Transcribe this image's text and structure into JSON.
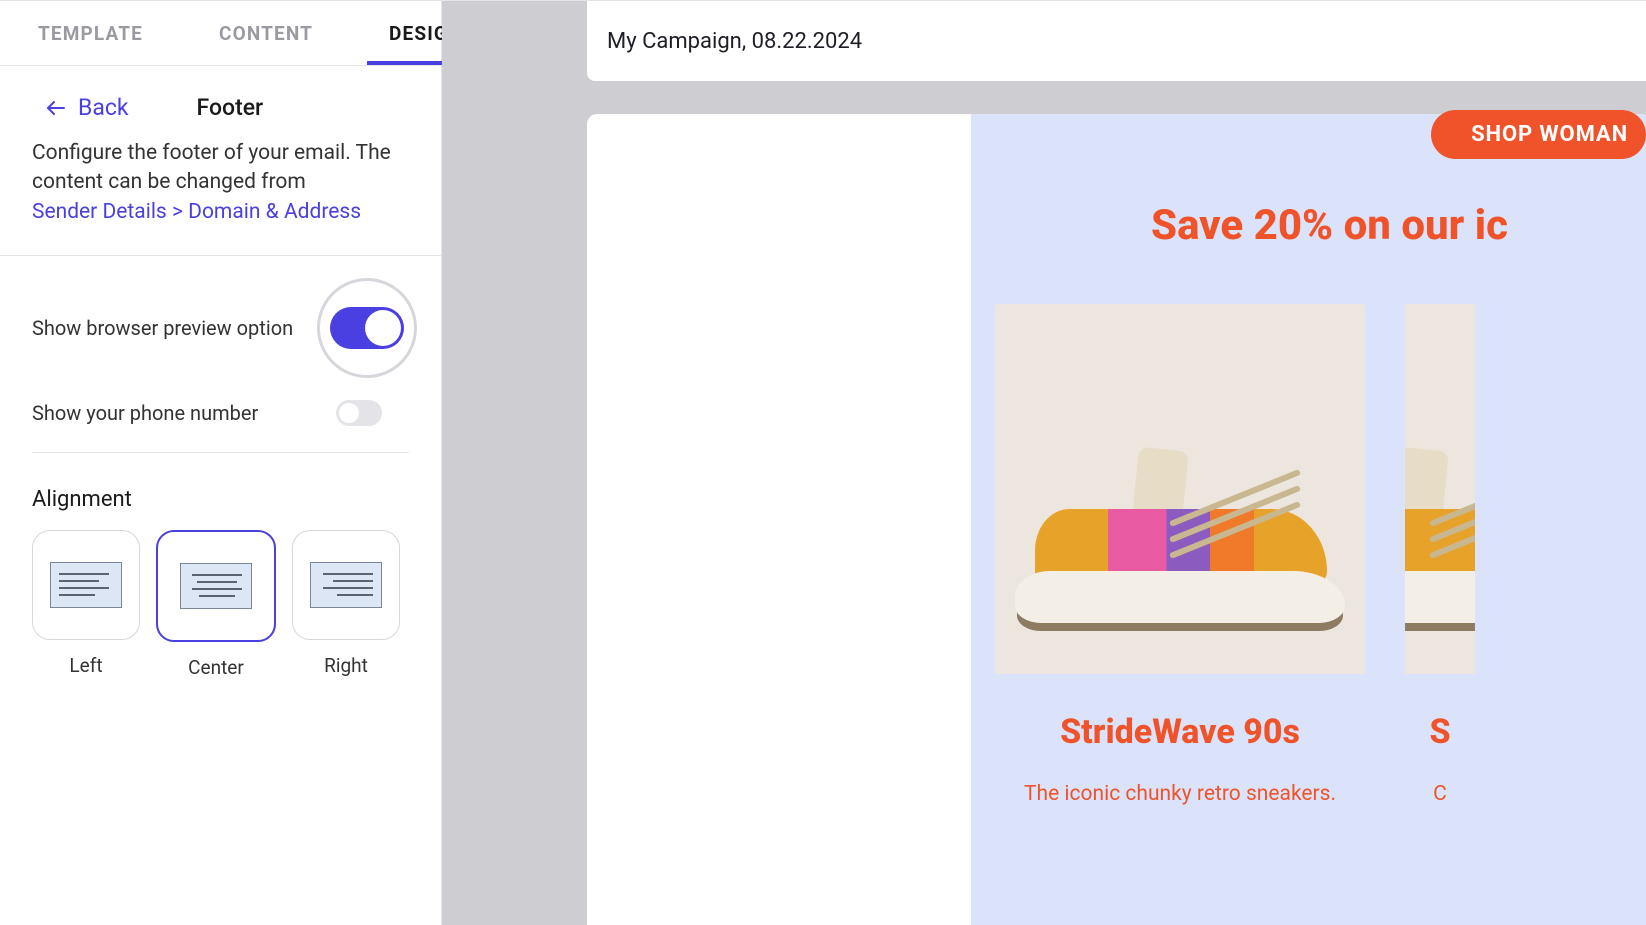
{
  "tabs": {
    "template": "TEMPLATE",
    "content": "CONTENT",
    "design": "DESIGN"
  },
  "back_label": "Back",
  "section_title": "Footer",
  "description_text": "Configure the footer of your email. The content can be changed from",
  "description_link": "Sender Details > Domain & Address",
  "toggles": {
    "browser_preview_label": "Show browser preview option",
    "phone_label": "Show your phone number"
  },
  "alignment": {
    "heading": "Alignment",
    "options": {
      "left": "Left",
      "center": "Center",
      "right": "Right"
    }
  },
  "campaign_title": "My Campaign, 08.22.2024",
  "preview": {
    "shop_button": "SHOP WOMAN",
    "headline": "Save 20% on our ic",
    "product1": {
      "title": "StrideWave 90s",
      "sub": "The iconic chunky retro sneakers."
    },
    "product2": {
      "title_peek": "S",
      "sub_peek": "C"
    }
  }
}
